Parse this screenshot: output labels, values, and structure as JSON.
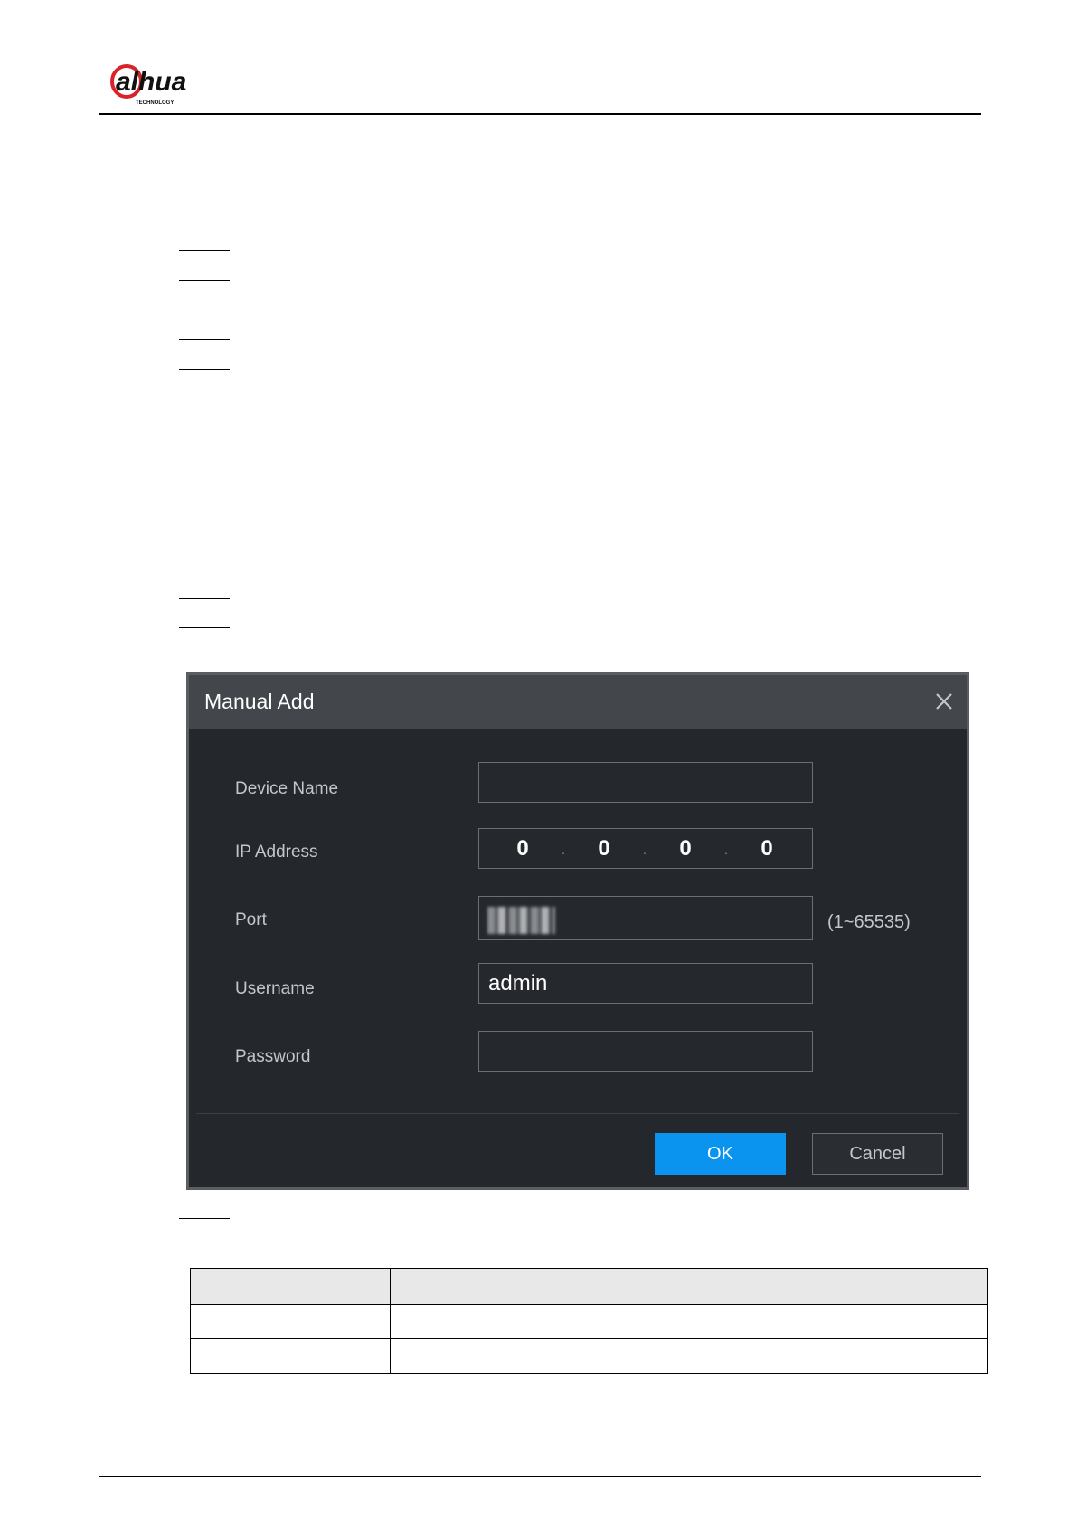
{
  "brand": {
    "logo_text": "alhua",
    "logo_subtext": "TECHNOLOGY",
    "accent": "#d8232a"
  },
  "dialog": {
    "title": "Manual Add",
    "close_icon": "close-icon",
    "fields": [
      {
        "label": "Device Name",
        "value": ""
      },
      {
        "label": "IP Address",
        "segments": [
          "0",
          "0",
          "0",
          "0"
        ]
      },
      {
        "label": "Port",
        "value": "",
        "hint": "(1~65535)"
      },
      {
        "label": "Username",
        "value": "admin"
      },
      {
        "label": "Password",
        "value": ""
      }
    ],
    "ok_label": "OK",
    "cancel_label": "Cancel",
    "colors": {
      "background": "#24272c",
      "header": "#43464b",
      "ok_button": "#0a94f0"
    }
  },
  "table": {
    "headers": [
      "",
      ""
    ],
    "rows": [
      [
        "",
        ""
      ],
      [
        "",
        ""
      ]
    ]
  }
}
